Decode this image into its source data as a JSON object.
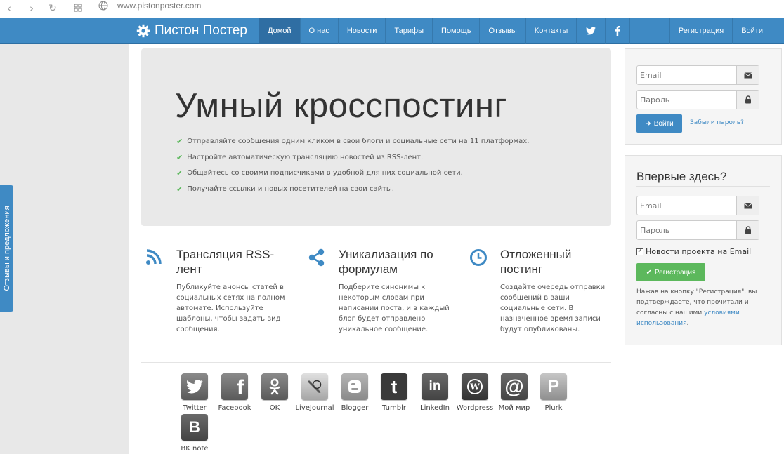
{
  "browser": {
    "url": "www.pistonposter.com"
  },
  "navbar": {
    "brand": "Пистон Постер",
    "items": [
      "Домой",
      "О нас",
      "Новости",
      "Тарифы",
      "Помощь",
      "Отзывы",
      "Контакты"
    ],
    "right": [
      "Регистрация",
      "Войти"
    ],
    "accent": "#3f8ac4"
  },
  "sidebar": {
    "feedback_tab": "Отзывы и предложения"
  },
  "hero": {
    "title": "Умный кросспостинг",
    "bullets": [
      "Отправляйте сообщения одним кликом в свои блоги и социальные сети на 11 платформах.",
      "Настройте автоматическую трансляцию новостей из RSS-лент.",
      "Общайтесь со своими подписчиками в удобной для них социальной сети.",
      "Получайте ссылки и новых посетителей на свои сайты."
    ]
  },
  "features": [
    {
      "icon": "rss-icon",
      "title": "Трансляция RSS-лент",
      "text": "Публикуйте анонсы статей в социальных сетях на полном автомате. Используйте шаблоны, чтобы задать вид сообщения."
    },
    {
      "icon": "share-icon",
      "title": "Уникализация по формулам",
      "text": "Подберите синонимы к некоторым словам при написании поста, и в каждый блог будет отправлено уникальное сообщение."
    },
    {
      "icon": "clock-icon",
      "title": "Отложенный постинг",
      "text": "Создайте очередь отправки сообщений в ваши социальные сети. В назначенное время записи будут опубликованы."
    }
  ],
  "social": [
    {
      "label": "Twitter",
      "glyph": "🐦"
    },
    {
      "label": "Facebook",
      "glyph": "f"
    },
    {
      "label": "OK",
      "glyph": "ok"
    },
    {
      "label": "LiveJournal",
      "glyph": "✎"
    },
    {
      "label": "Blogger",
      "glyph": "B"
    },
    {
      "label": "Tumblr",
      "glyph": "t"
    },
    {
      "label": "LinkedIn",
      "glyph": "in"
    },
    {
      "label": "Wordpress",
      "glyph": "W"
    },
    {
      "label": "Мой мир",
      "glyph": "@"
    },
    {
      "label": "Plurk",
      "glyph": "P"
    },
    {
      "label": "BK note",
      "glyph": "B"
    }
  ],
  "login": {
    "email_placeholder": "Email",
    "password_placeholder": "Пароль",
    "submit": "Войти",
    "forgot": "Забыли пароль?",
    "button_color": "#3f8ac4"
  },
  "register": {
    "heading": "Впервые здесь?",
    "email_placeholder": "Email",
    "password_placeholder": "Пароль",
    "newsletter": "Новости проекта на Email",
    "newsletter_checked": true,
    "submit": "Регистрация",
    "button_color": "#5cb85c",
    "terms_prefix": "Нажав на кнопку \"Регистрация\", вы подтверждаете, что прочитали и согласны с нашими",
    "terms_link": "условиями использования",
    "terms_suffix": "."
  }
}
